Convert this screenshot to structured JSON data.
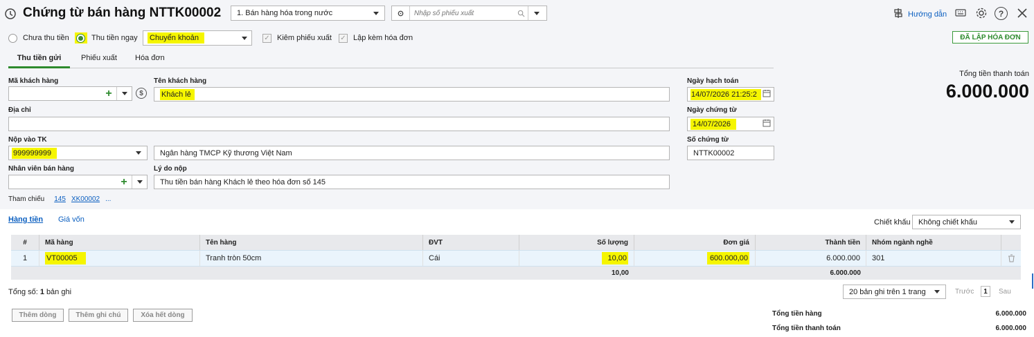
{
  "header": {
    "title": "Chứng từ bán hàng NTTK00002",
    "sale_type": "1. Bán hàng hóa trong nước",
    "voucher_placeholder": "Nhập số phiếu xuất",
    "guide_label": "Hướng dẫn"
  },
  "payment": {
    "unpaid_label": "Chưa thu tiền",
    "paid_label": "Thu tiền ngay",
    "method": "Chuyển khoản",
    "check_export_label": "Kiêm phiếu xuất",
    "check_invoice_label": "Lập kèm hóa đơn",
    "invoice_status": "ĐÃ LẬP HÓA ĐƠN"
  },
  "tabs": [
    "Thu tiền gửi",
    "Phiếu xuất",
    "Hóa đơn"
  ],
  "form": {
    "customer_code_label": "Mã khách hàng",
    "customer_code": "",
    "customer_name_label": "Tên khách hàng",
    "customer_name": "Khách lẻ",
    "address_label": "Địa chỉ",
    "address": "",
    "deposit_label": "Nộp vào TK",
    "deposit_account": "999999999",
    "bank_name": "Ngân hàng TMCP Kỹ thương Việt Nam",
    "staff_label": "Nhân viên bán hàng",
    "staff": "",
    "reason_label": "Lý do nộp",
    "reason": "Thu tiền bán hàng Khách lẻ theo hóa đơn số 145",
    "accounting_date_label": "Ngày hạch toán",
    "accounting_date": "14/07/2026 21:25:2",
    "voucher_date_label": "Ngày chứng từ",
    "voucher_date": "14/07/2026",
    "voucher_no_label": "Số chứng từ",
    "voucher_no": "NTTK00002",
    "reference_label": "Tham chiếu",
    "ref1": "145",
    "ref2": "XK00002",
    "ref_more": "..."
  },
  "total_payment": {
    "label": "Tổng tiền thanh toán",
    "value": "6.000.000"
  },
  "subtabs": [
    "Hàng tiền",
    "Giá vốn"
  ],
  "discount": {
    "label": "Chiết khấu",
    "value": "Không chiết khấu"
  },
  "table": {
    "headers": [
      "#",
      "Mã hàng",
      "Tên hàng",
      "ĐVT",
      "Số lượng",
      "Đơn giá",
      "Thành tiền",
      "Nhóm ngành nghề"
    ],
    "rows": [
      [
        "1",
        "VT00005",
        "Tranh tròn 50cm",
        "Cái",
        "10,00",
        "600.000,00",
        "6.000.000",
        "301"
      ]
    ],
    "footer": {
      "quantity": "10,00",
      "amount": "6.000.000"
    }
  },
  "pager": {
    "total_prefix": "Tổng số:",
    "total_count": "1",
    "total_suffix": "bản ghi",
    "page_size": "20 bản ghi trên 1 trang",
    "prev": "Trước",
    "page": "1",
    "next": "Sau"
  },
  "actions": [
    "Thêm dòng",
    "Thêm ghi chú",
    "Xóa hết dòng"
  ],
  "summary": {
    "goods_label": "Tổng tiền hàng",
    "goods_value": "6.000.000",
    "payment_label": "Tổng tiền thanh toán",
    "payment_value": "6.000.000"
  }
}
